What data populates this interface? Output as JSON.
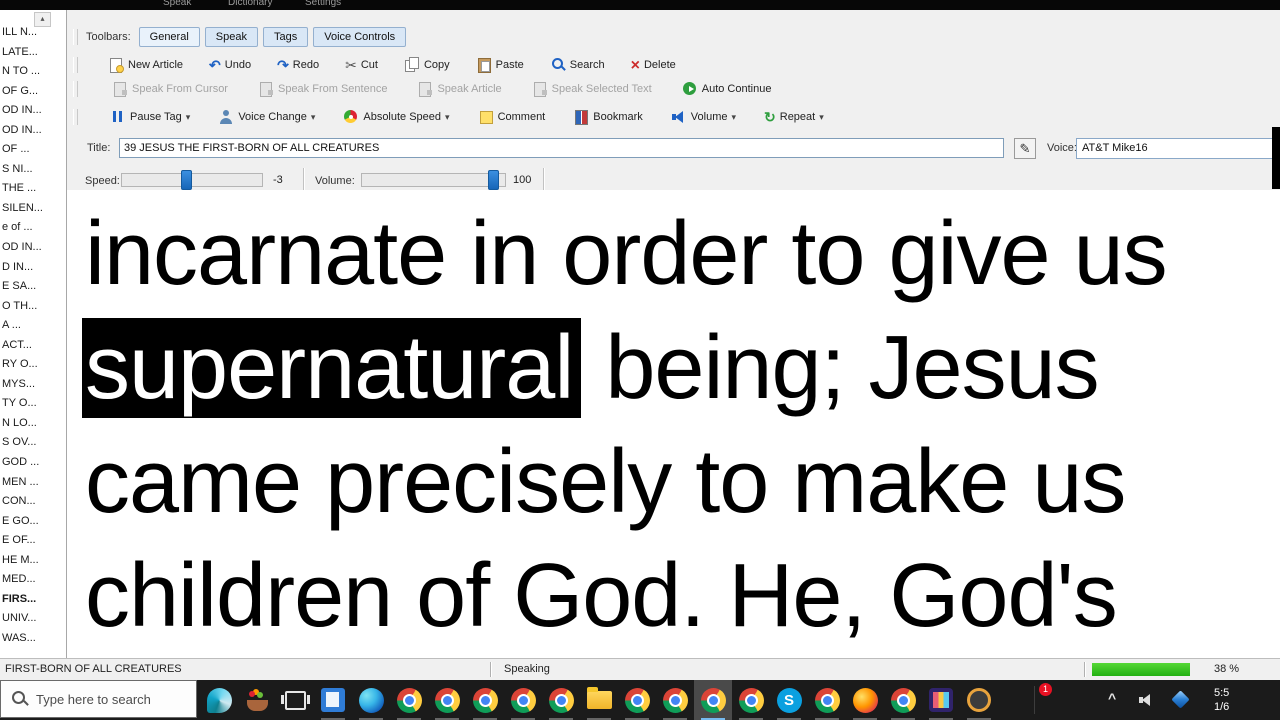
{
  "window": {
    "menu_fragments": [
      "Speak",
      "Dictionary",
      "Settings"
    ]
  },
  "glyphs": {
    "undo": "↶",
    "redo": "↷",
    "cut": "✂",
    "delete": "×",
    "repeat": "↻",
    "dropdown": "▾",
    "pencil": "✎",
    "scroll_up": "▴",
    "chevron_up": "^"
  },
  "sidebar": {
    "items": [
      "ILL N...",
      "LATE...",
      "N TO ...",
      "OF G...",
      "OD IN...",
      "OD IN...",
      "OF ...",
      "S NI...",
      "THE ...",
      "SILEN...",
      "e of ...",
      "OD IN...",
      "D IN...",
      "E SA...",
      "O TH...",
      "A ...",
      "ACT...",
      "RY O...",
      "MYS...",
      "TY O...",
      "N LO...",
      "S OV...",
      "GOD ...",
      "MEN ...",
      "CON...",
      "E GO...",
      "E OF...",
      "HE M...",
      "MED...",
      "FIRS...",
      "UNIV...",
      "WAS..."
    ],
    "selected_index": 29
  },
  "toolbar": {
    "toolbars_label": "Toolbars:",
    "tabs": [
      "General",
      "Speak",
      "Tags",
      "Voice Controls"
    ],
    "edit_buttons": [
      "New Article",
      "Undo",
      "Redo",
      "Cut",
      "Copy",
      "Paste",
      "Search",
      "Delete"
    ],
    "speak_buttons": [
      "Speak From Cursor",
      "Speak From Sentence",
      "Speak Article",
      "Speak Selected Text",
      "Auto Continue"
    ],
    "tag_buttons": [
      "Pause Tag",
      "Voice Change",
      "Absolute Speed",
      "Comment",
      "Bookmark",
      "Volume",
      "Repeat"
    ]
  },
  "title_row": {
    "title_label": "Title:",
    "title_value": "39 JESUS THE FIRST-BORN OF ALL CREATURES",
    "voice_label": "Voice:",
    "voice_value": "AT&T Mike16"
  },
  "controls_row": {
    "speed_label": "Speed:",
    "speed_value": "-3",
    "volume_label": "Volume:",
    "volume_value": "100"
  },
  "document": {
    "line1": "incarnate in order to give us",
    "line2_highlight": "supernatural",
    "line2_rest": " being; Jesus ",
    "line3": "came precisely to make us",
    "line4": "children of God. He, God's"
  },
  "status_bar": {
    "section1": "FIRST-BORN OF ALL CREATURES",
    "section2": "Speaking",
    "progress_percent": 38,
    "progress_label": "38 %"
  },
  "taskbar": {
    "search_placeholder": "Type here to search",
    "notification_badge": "1",
    "clock_time": "5:5",
    "clock_date": "1/6",
    "icons": [
      "paint-swirl",
      "fruit-basket",
      "task-view",
      "calculator",
      "edge",
      "chrome",
      "chrome",
      "chrome",
      "chrome",
      "chrome",
      "folder",
      "chrome",
      "chrome",
      "chrome-active",
      "chrome",
      "skype",
      "chrome",
      "firefox",
      "chrome",
      "film-reel",
      "media-player"
    ]
  }
}
